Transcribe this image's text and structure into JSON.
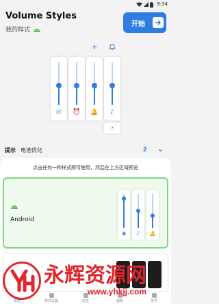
{
  "status": {
    "time": "9:34"
  },
  "header": {
    "title": "Volume Styles",
    "subtitle": "我的样式"
  },
  "start_button": {
    "label": "开始"
  },
  "preview": {
    "sliders": [
      {
        "icon": "phone-icon",
        "glyph": "☏",
        "level": 0.45
      },
      {
        "icon": "alarm-icon",
        "glyph": "⏰",
        "level": 0.45
      },
      {
        "icon": "bell-icon",
        "glyph": "🔔",
        "level": 0.45
      },
      {
        "icon": "music-note-icon",
        "glyph": "♪",
        "level": 0.45
      }
    ],
    "more_glyph": "›",
    "add_glyph": "+",
    "bell_glyph": "🔔"
  },
  "hint": {
    "label": "提示",
    "text": "电池优化",
    "count": "2",
    "chevron": "⌄"
  },
  "styles": {
    "instruction": "点击任何一种样式即可使用，然后在上方区域预览",
    "selected": {
      "name": "Android",
      "sliders": [
        {
          "icon": "target-icon",
          "glyph": "◉",
          "level": 0.85
        },
        {
          "icon": "music-note-icon",
          "glyph": "♪",
          "level": 0.5
        },
        {
          "icon": "bell-icon",
          "glyph": "🔔",
          "level": 0.35
        }
      ]
    }
  },
  "bottom_nav": [
    {
      "label": "样式",
      "active": true
    },
    {
      "label": "样式设置",
      "active": false
    },
    {
      "label": "定位",
      "active": false
    },
    {
      "label": "面板",
      "active": false
    },
    {
      "label": "关于",
      "active": false
    }
  ],
  "watermark": {
    "logo": "YH",
    "text": "永辉资源网",
    "url": "www.yhkjj.com"
  }
}
